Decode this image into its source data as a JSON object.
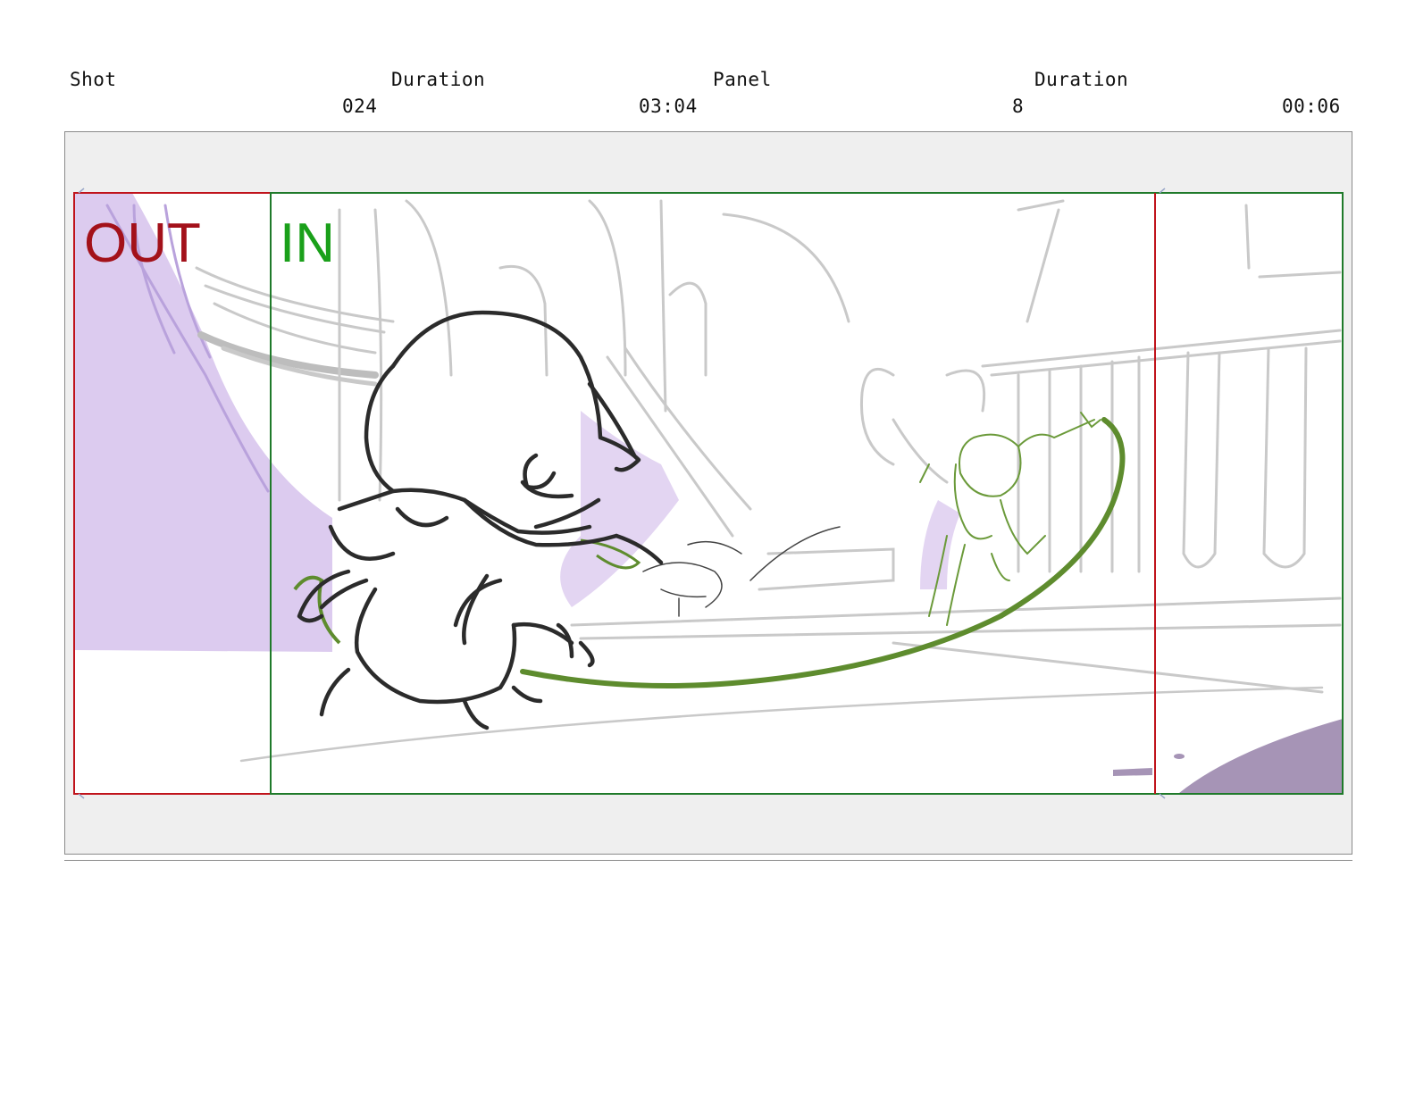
{
  "header": {
    "shot_label": "Shot",
    "shot_value": "024",
    "shot_duration_label": "Duration",
    "shot_duration_value": "03:04",
    "panel_label": "Panel",
    "panel_value": "8",
    "panel_duration_label": "Duration",
    "panel_duration_value": "00:06"
  },
  "panel": {
    "out_label": "OUT",
    "in_label": "IN"
  },
  "colors": {
    "out_frame": "#c0131b",
    "in_frame": "#1f7a2a",
    "out_text": "#a3111a",
    "in_text": "#1aa01a",
    "shadow_violet": "#d9c8ef",
    "sketch_green": "#5e8c2e"
  }
}
